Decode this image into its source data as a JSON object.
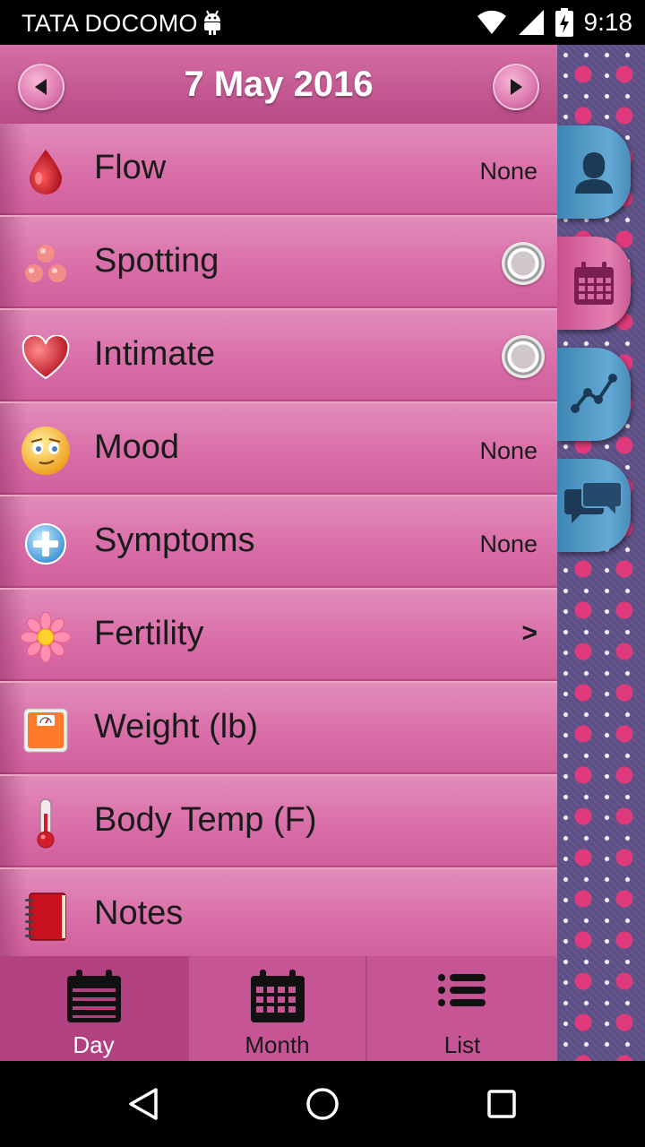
{
  "status_bar": {
    "carrier": "TATA DOCOMO",
    "time": "9:18",
    "icons": [
      "android-icon",
      "wifi-icon",
      "signal-icon",
      "battery-charging-icon"
    ]
  },
  "header": {
    "date": "7 May 2016",
    "prev_icon": "triangle-left",
    "next_icon": "triangle-right"
  },
  "rows": [
    {
      "label": "Flow",
      "value": "None",
      "icon": "blood-drop-icon"
    },
    {
      "label": "Spotting",
      "value": "",
      "icon": "spotting-dots-icon",
      "control": "radio"
    },
    {
      "label": "Intimate",
      "value": "",
      "icon": "heart-icon",
      "control": "radio"
    },
    {
      "label": "Mood",
      "value": "None",
      "icon": "smiley-face-icon"
    },
    {
      "label": "Symptoms",
      "value": "None",
      "icon": "plus-circle-icon"
    },
    {
      "label": "Fertility",
      "value": ">",
      "icon": "flower-icon"
    },
    {
      "label": "Weight (lb)",
      "value": "",
      "icon": "scale-icon"
    },
    {
      "label": "Body Temp (F)",
      "value": "",
      "icon": "thermometer-icon"
    },
    {
      "label": "Notes",
      "value": "",
      "icon": "notebook-icon"
    }
  ],
  "side_tabs": [
    {
      "icon": "person-icon",
      "color": "#5aa0cf"
    },
    {
      "icon": "calendar-icon",
      "color": "#dc6fa6"
    },
    {
      "icon": "chart-line-icon",
      "color": "#5aa0cf"
    },
    {
      "icon": "chat-bubbles-icon",
      "color": "#5aa0cf"
    }
  ],
  "bottom_tabs": [
    {
      "label": "Day",
      "active": true,
      "icon": "calendar-day-icon"
    },
    {
      "label": "Month",
      "active": false,
      "icon": "calendar-month-icon"
    },
    {
      "label": "List",
      "active": false,
      "icon": "list-icon"
    }
  ],
  "colors": {
    "panel_pink": "#d970a8",
    "header_pink": "#b84a86",
    "tab_active": "#b24182",
    "side_blue": "#5aa0cf"
  }
}
